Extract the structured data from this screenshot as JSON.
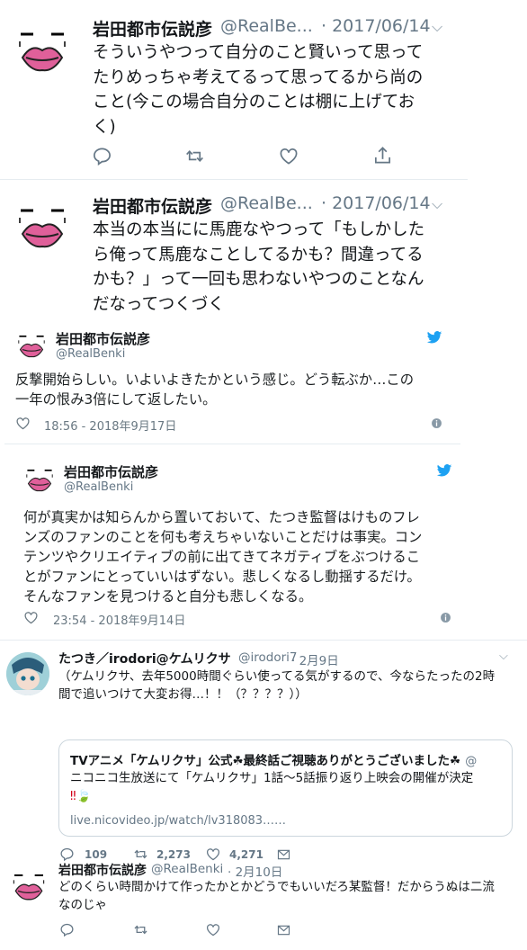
{
  "tweet1": {
    "name": "岩田都市伝説彦",
    "handle": "@RealBe...",
    "date": "· 2017/06/14",
    "lines": [
      "そういうやつって自分のこと賢いって思って",
      "たりめっちゃ考えてるって思ってるから尚の",
      "こと(今この場合自分のことは棚に上げてお",
      "く)"
    ]
  },
  "tweet2": {
    "name": "岩田都市伝説彦",
    "handle": "@RealBe...",
    "date": "· 2017/06/14",
    "lines": [
      "本当の本当にに馬鹿なやつって「もしかした",
      "ら俺って馬鹿なことしてるかも？間違ってる",
      "かも？」って一回も思わないやつのことなん",
      "だなってつくづく"
    ]
  },
  "embed1": {
    "name": "岩田都市伝説彦",
    "handle": "@RealBenki",
    "lines": [
      "反撃開始らしい。いよいよきたかという感じ。どう転ぶか…この",
      "一年の恨み3倍にして返したい。"
    ],
    "timestamp": "18:56 - 2018年9月17日"
  },
  "embed2": {
    "name": "岩田都市伝説彦",
    "handle": "@RealBenki",
    "lines": [
      "何が真実かは知らんから置いておいて、たつき監督はけものフレ",
      "ンズのファンのことを何も考えちゃいないことだけは事実。コン",
      "テンツやクリエイティブの前に出てきてネガティブをぶつけるこ",
      "とがファンにとっていいはずない。悲しくなるし動揺するだけ。",
      "そんなファンを見つけると自分も悲しくなる。"
    ],
    "timestamp": "23:54 - 2018年9月14日"
  },
  "tweet3": {
    "name": "たつき／irodori@ケムリクサ",
    "handle": "@irodori7",
    "date": "· 2月9日",
    "lines": [
      "（ケムリクサ、去年5000時間ぐらい使ってる気がするので、今ならたったの2時",
      "間で追いつけて大変お得…！！（？？？？））"
    ],
    "quote": {
      "title": "TVアニメ「ケムリクサ」公式☘最終話ご視聴ありがとうございました☘",
      "title_handle": "@",
      "line2": "ニコニコ生放送にて「ケムリクサ」1話～5話振り返り上映会の開催が決定",
      "line3": "‼🍃",
      "link": "live.nicovideo.jp/watch/lv318083……"
    },
    "stats": {
      "replies": "109",
      "retweets": "2,273",
      "likes": "4,271"
    }
  },
  "tweet4": {
    "name": "岩田都市伝説彦",
    "handle": "@RealBenki",
    "date": "· 2月10日",
    "lines": [
      "どのくらい時間かけて作ったかとかどうでもいいだろ某監督！だからうぬは二流",
      "なのじゃ"
    ]
  },
  "colors": {
    "twitter_blue": "#1da1f2",
    "lips": "#e0609a",
    "icon_gray": "#657786"
  }
}
